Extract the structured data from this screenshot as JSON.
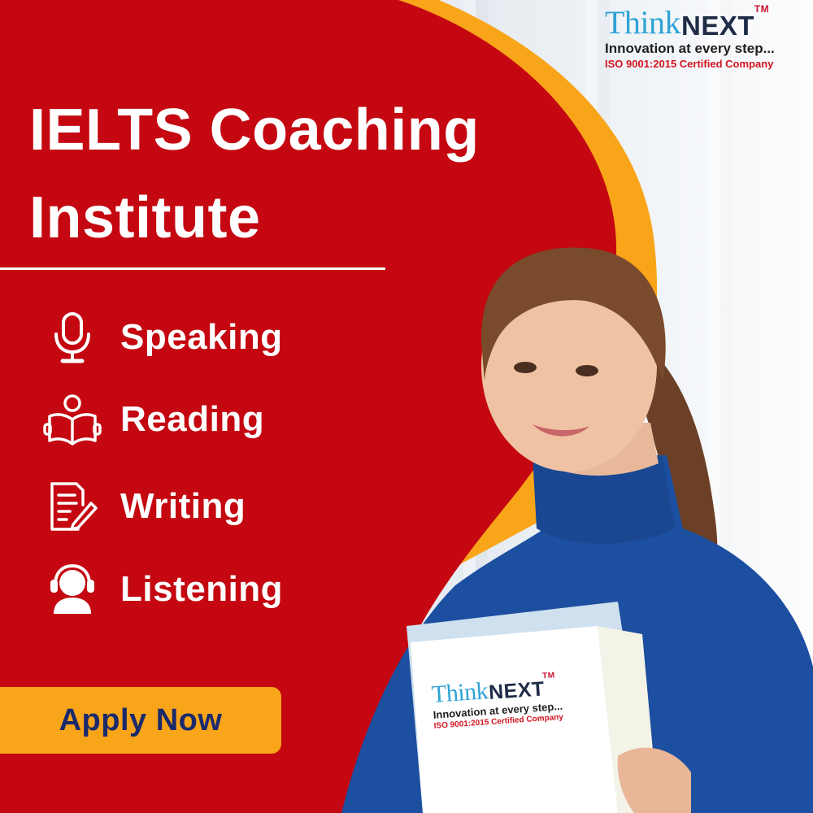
{
  "colors": {
    "red_panel": "#c40710",
    "orange_arc": "#f9a51a",
    "button_text": "#1b2a6b",
    "logo_blue": "#2ea3d6",
    "logo_navy": "#1f2c47",
    "logo_red": "#d0151f"
  },
  "logo": {
    "think": "Think",
    "next": "NEXT",
    "tm": "TM",
    "tagline": "Innovation at every step...",
    "iso": "ISO 9001:2015 Certified Company"
  },
  "headline": {
    "line1": "IELTS Coaching",
    "line2": "Institute"
  },
  "skills": [
    {
      "label": "Speaking",
      "icon": "microphone-icon"
    },
    {
      "label": "Reading",
      "icon": "reading-person-icon"
    },
    {
      "label": "Writing",
      "icon": "document-pen-icon"
    },
    {
      "label": "Listening",
      "icon": "headset-person-icon"
    }
  ],
  "cta": {
    "label": "Apply Now"
  },
  "folder_logo": {
    "think": "Think",
    "next": "NEXT",
    "tm": "TM",
    "tagline": "Innovation at every step...",
    "iso": "ISO 9001:2015 Certified Company"
  }
}
